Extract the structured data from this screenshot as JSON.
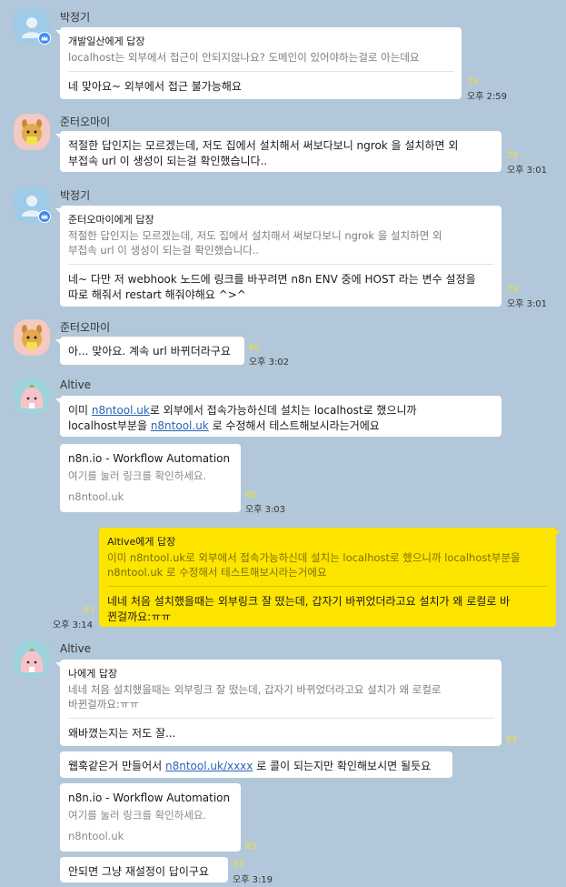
{
  "senders": {
    "park": "박정기",
    "jun": "준터오마이",
    "altive": "Altive"
  },
  "messages": {
    "m1": {
      "reply_head": "개발일산에게 답장",
      "reply_quote": "localhost는 외부에서 접근이 안되지않나요? 도메인이 있어야하는걸로 아는데요",
      "text": "네 맞아요~ 외부에서 접근 불가능해요",
      "count": "79",
      "time": "오후 2:59"
    },
    "m2": {
      "line1": "적절한 답인지는 모르겠는데, 저도 집에서 설치해서 써보다보니 ngrok 을 설치하면 외",
      "line2": "부접속 url 이 생성이 되는걸 확인했습니다..",
      "count": "79",
      "time": "오후 3:01"
    },
    "m3": {
      "reply_head": "준터오마이에게 답장",
      "quote1": "적절한 답인지는 모르겠는데, 저도 집에서 설치해서 써보다보니 ngrok 을 설치하면 외",
      "quote2": "부접속 url 이 생성이 되는걸 확인했습니다..",
      "line1": "네~ 다만 저 webhook 노드에 링크를 바꾸려면 n8n ENV 중에 HOST 라는 변수 설정을",
      "line2": "따로 해줘서 restart 해줘야해요 ^>^",
      "count": "79",
      "time": "오후 3:01"
    },
    "m4": {
      "text": "아... 맞아요. 계속 url 바뀌더라구요",
      "count": "80",
      "time": "오후 3:02"
    },
    "m5": {
      "p1": "이미 ",
      "link1": "n8ntool.uk",
      "p2": "로 외부에서 접속가능하신데 설치는 localhost로 했으니까",
      "p3": "localhost부분을 ",
      "link2": "n8ntool.uk",
      "p4": " 로 수정해서 테스트해보시라는거에요"
    },
    "card1": {
      "title": "n8n.io - Workflow Automation",
      "desc": "여기를 눌러 링크를 확인하세요.",
      "domain": "n8ntool.uk",
      "count": "80",
      "time": "오후 3:03"
    },
    "m6": {
      "reply_head": "Altive에게 답장",
      "quote1": "이미 n8ntool.uk로 외부에서 접속가능하신데 설치는 localhost로 했으니까 localhost부분을",
      "quote2": "n8ntool.uk 로 수정해서 테스트해보시라는거에요",
      "line1": "네네 처음 설치했을때는 외부링크 잘 떴는데, 갑자기 바뀌었더라고요 설치가 왜 로컬로 바",
      "line2": "뀐걸까요:ㅠㅠ",
      "count": "83",
      "time": "오후 3:14"
    },
    "m7": {
      "reply_head": "나에게 답장",
      "quote1": "네네 처음 설치했을때는 외부링크 잘 떴는데, 갑자기 바뀌었더라고요 설치가 왜 로컬로",
      "quote2": "바뀐걸까요:ㅠㅠ",
      "text": "왜바꼈는지는 저도 잘...",
      "count": "83"
    },
    "m8": {
      "p1": "웹훅같은거 만들어서 ",
      "link": "n8ntool.uk/xxxx",
      "p2": " 로 콜이 되는지만 확인해보시면 될듯요"
    },
    "card2": {
      "title": "n8n.io - Workflow Automation",
      "desc": "여기를 눌러 링크를 확인하세요.",
      "domain": "n8ntool.uk",
      "count": "83"
    },
    "m9": {
      "text": "안되면 그냥 재설정이 답이구요",
      "count": "83",
      "time": "오후 3:19"
    }
  },
  "colors": {
    "background": "#b2c7d9",
    "mine_bubble": "#fee500",
    "other_bubble": "#ffffff",
    "unread_count": "#f2df3a",
    "link": "#2a64b8"
  }
}
